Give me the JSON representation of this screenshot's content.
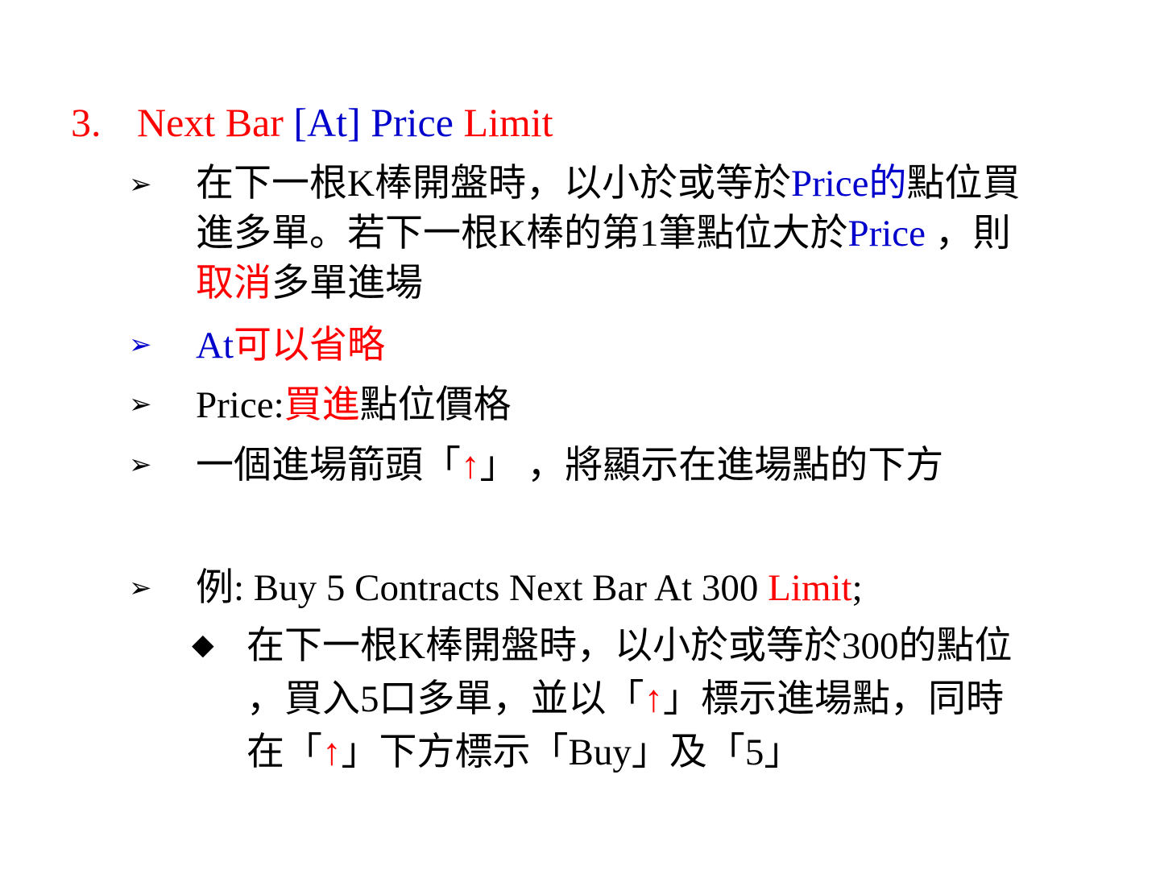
{
  "title": {
    "number": "3.",
    "part1": "Next Bar ",
    "part2": "[At] Price",
    "part3": "  Limit"
  },
  "bullet_glyph": "➢",
  "sub_bullet_glyph": "◆",
  "bullets": [
    {
      "line1_a": "在下一根K棒開盤時，以小於或等於",
      "line1_b": "Price的",
      "line1_c": "點位買",
      "line2_a": "進多單。若下一根K棒的第1筆點位大於",
      "line2_b": "Price",
      "line2_c": " ，則",
      "line3_a": "取消",
      "line3_b": "多單進場"
    },
    {
      "a": "At",
      "b": "可以省略"
    },
    {
      "a": "Price:",
      "b": "買進",
      "c": "點位價格"
    },
    {
      "a": "一個進場箭頭「",
      "b": "↑",
      "c": "」 ，將顯示在進場點的下方"
    },
    {
      "a": "例: Buy 5 Contracts Next Bar At 300 ",
      "b": "Limit",
      "c": ";"
    }
  ],
  "sub_bullet": {
    "line1": "在下一根K棒開盤時，以小於或等於300的點位",
    "line2_a": "，買入5口多單，並以「",
    "line2_b": "↑",
    "line2_c": "」標示進場點，同時",
    "line3_a": "在「",
    "line3_b": "↑",
    "line3_c": "」下方標示「Buy」及「5」"
  }
}
